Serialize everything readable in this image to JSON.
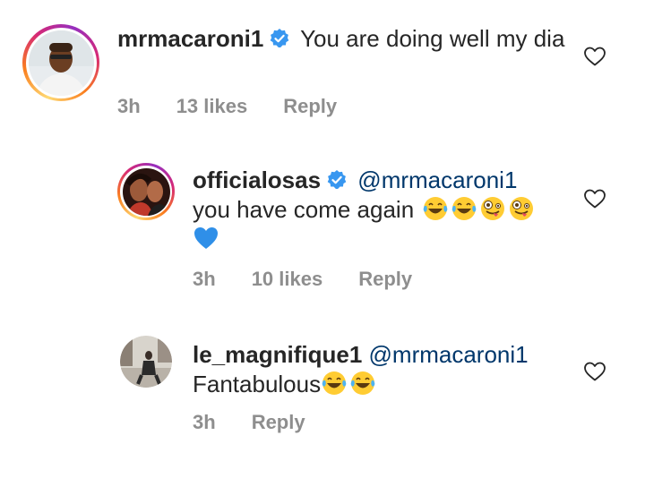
{
  "comments": [
    {
      "username": "mrmacaroni1",
      "verified": true,
      "mention": "",
      "text": "You are doing well my dia",
      "time": "3h",
      "likes": "13 likes",
      "reply": "Reply"
    },
    {
      "username": "officialosas",
      "verified": true,
      "mention": "@mrmacaroni1",
      "text": "you have come again",
      "time": "3h",
      "likes": "10 likes",
      "reply": "Reply"
    },
    {
      "username": "le_magnifique1",
      "verified": false,
      "mention": "@mrmacaroni1",
      "text": "Fantabulous",
      "time": "3h",
      "likes": "",
      "reply": "Reply"
    }
  ],
  "colors": {
    "text": "#262626",
    "meta": "#8e8e8e",
    "mention": "#00376b",
    "verified": "#3897f0"
  },
  "icons": [
    "verified-badge-icon",
    "heart-outline-icon",
    "laughing-tears-emoji",
    "zany-face-emoji",
    "blue-heart-emoji"
  ]
}
